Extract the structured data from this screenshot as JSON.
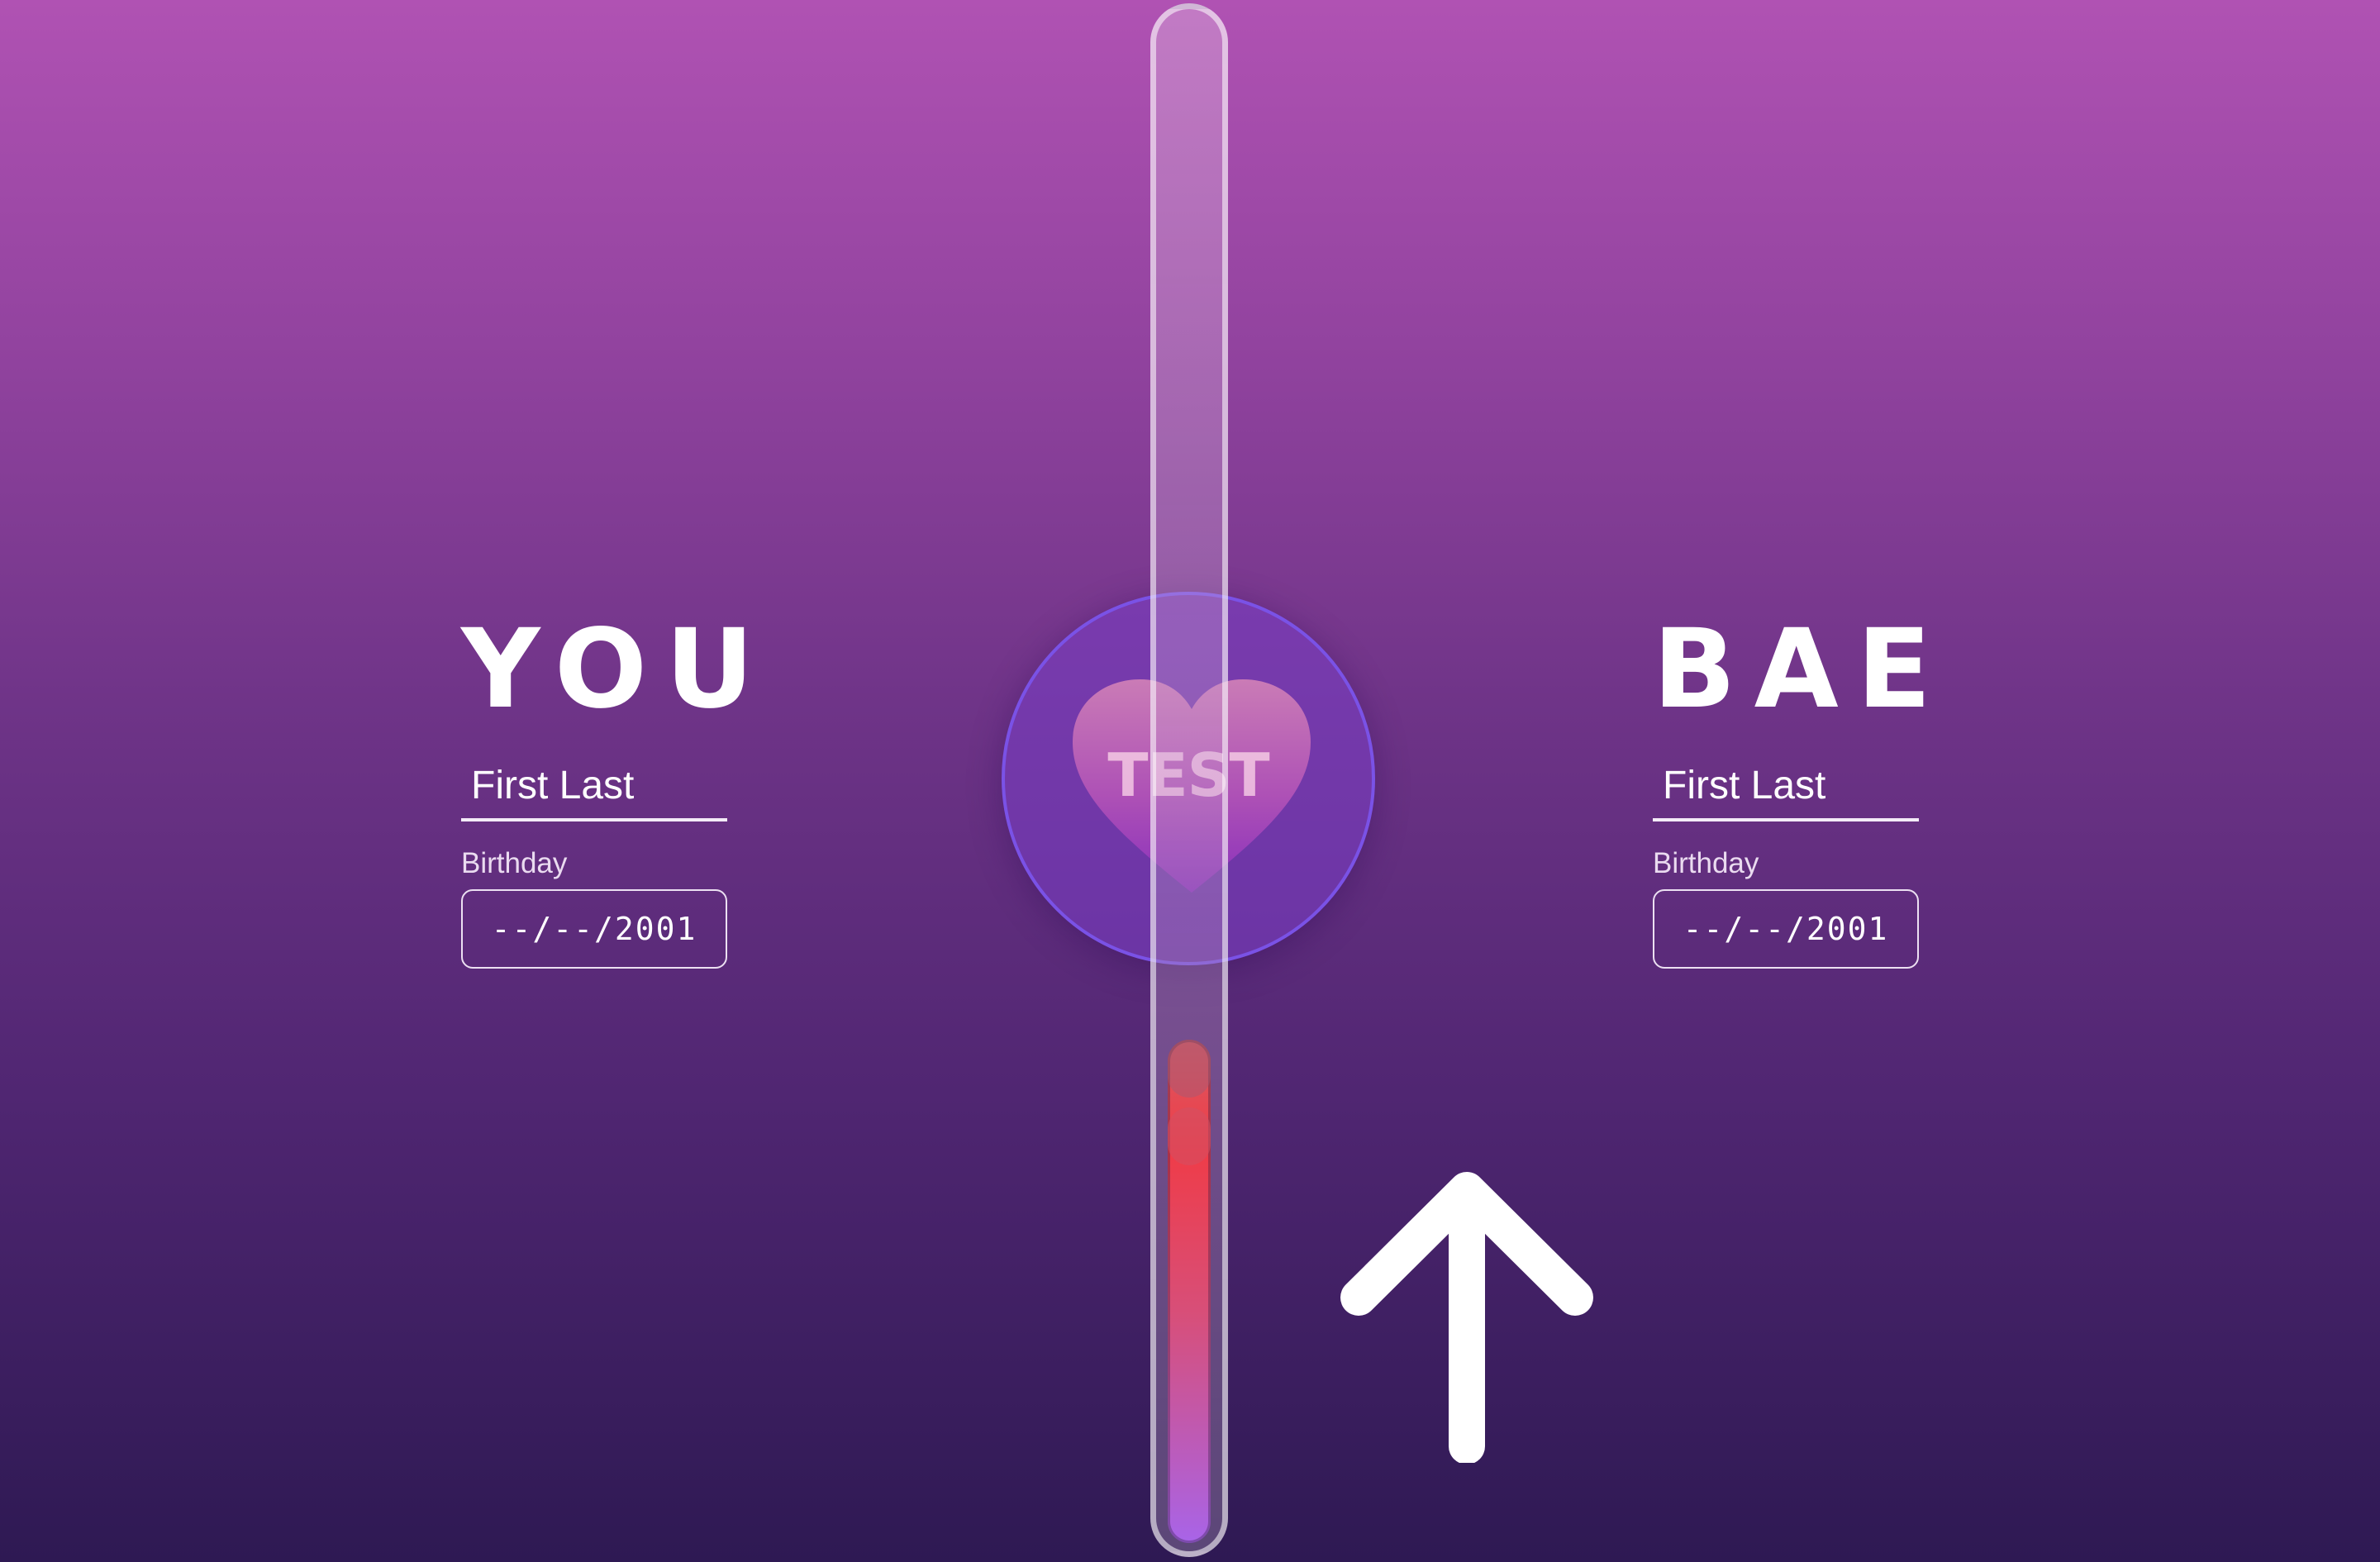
{
  "you": {
    "heading": "YOU",
    "name_placeholder": "First Last",
    "birthday_label": "Birthday",
    "birthday_placeholder": "--/--/2001"
  },
  "bae": {
    "heading": "BAE",
    "name_placeholder": "First Last",
    "birthday_label": "Birthday",
    "birthday_placeholder": "--/--/2001"
  },
  "test_button": {
    "label": "TEST",
    "icon": "heart-icon"
  },
  "love_meter": {
    "fill_fraction": 0.33
  },
  "swipe_hint": {
    "icon": "arrow-up-icon"
  },
  "colors": {
    "background_top": "#b052b3",
    "background_bottom": "#2e1953",
    "meter_fill_top": "#ef3c48",
    "meter_fill_bottom": "#a864e8",
    "button_ring": "#7a52e6"
  }
}
